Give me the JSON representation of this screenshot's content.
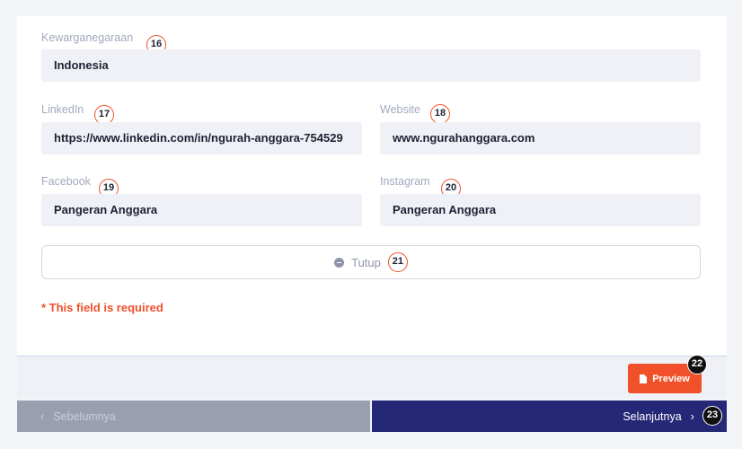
{
  "form": {
    "citizenship": {
      "label": "Kewarganegaraan",
      "value": "Indonesia",
      "badge": "16"
    },
    "linkedin": {
      "label": "LinkedIn",
      "value": "https://www.linkedin.com/in/ngurah-anggara-754529",
      "badge": "17"
    },
    "website": {
      "label": "Website",
      "value": "www.ngurahanggara.com",
      "badge": "18"
    },
    "facebook": {
      "label": "Facebook",
      "value": "Pangeran Anggara",
      "badge": "19"
    },
    "instagram": {
      "label": "Instagram",
      "value": "Pangeran Anggara",
      "badge": "20"
    }
  },
  "close_button": {
    "label": "Tutup",
    "icon": "minus-circle-icon",
    "badge": "21"
  },
  "required_note": "* This field is required",
  "preview_button": {
    "label": "Preview",
    "icon": "document-icon",
    "badge": "22"
  },
  "nav": {
    "prev_label": "Sebelumnya",
    "next_label": "Selanjutnya",
    "next_badge": "23"
  },
  "colors": {
    "accent": "#f0502a",
    "nav_next_bg": "#242876",
    "nav_prev_bg": "#9a9fb0",
    "input_bg": "#eff1f6"
  }
}
